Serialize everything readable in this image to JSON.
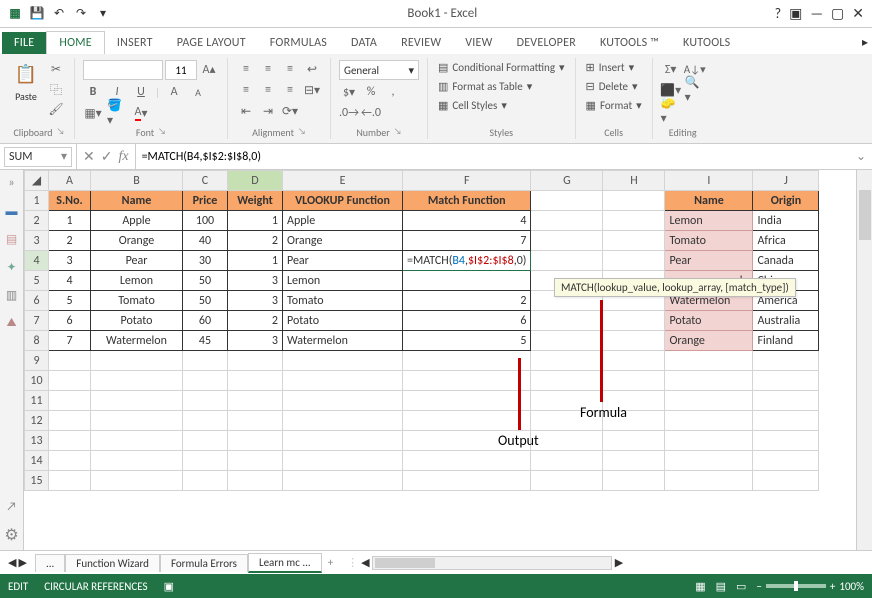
{
  "title": "Book1 - Excel",
  "tabs": {
    "file": "FILE",
    "home": "HOME",
    "insert": "INSERT",
    "page_layout": "PAGE LAYOUT",
    "formulas": "FORMULAS",
    "data": "DATA",
    "review": "REVIEW",
    "view": "VIEW",
    "developer": "DEVELOPER",
    "kutools_tm": "KUTOOLS ™",
    "kutools": "KUTOOLS"
  },
  "ribbon": {
    "clipboard": {
      "label": "Clipboard",
      "paste": "Paste"
    },
    "font": {
      "label": "Font",
      "name": "",
      "size": "11",
      "bold": "B",
      "italic": "I",
      "underline": "U"
    },
    "alignment": {
      "label": "Alignment"
    },
    "number": {
      "label": "Number",
      "format": "General"
    },
    "styles": {
      "label": "Styles",
      "cond": "Conditional Formatting",
      "table": "Format as Table",
      "cell": "Cell Styles"
    },
    "cells": {
      "label": "Cells",
      "insert": "Insert",
      "delete": "Delete",
      "format": "Format"
    },
    "editing": {
      "label": "Editing"
    }
  },
  "formula_bar": {
    "name": "SUM",
    "formula": "=MATCH(B4,$I$2:$I$8,0)"
  },
  "columns": [
    "A",
    "B",
    "C",
    "D",
    "E",
    "F",
    "G",
    "H",
    "I",
    "J"
  ],
  "header_row": {
    "sno": "S.No.",
    "name": "Name",
    "price": "Price",
    "weight": "Weight",
    "vlook": "VLOOKUP Function",
    "match": "Match Function",
    "name2": "Name",
    "origin": "Origin"
  },
  "rows": [
    {
      "r": "2",
      "sno": "1",
      "name": "Apple",
      "price": "100",
      "weight": "1",
      "vlook": "Apple",
      "match": "4",
      "name2": "Lemon",
      "origin": "India"
    },
    {
      "r": "3",
      "sno": "2",
      "name": "Orange",
      "price": "40",
      "weight": "2",
      "vlook": "Orange",
      "match": "7",
      "name2": "Tomato",
      "origin": "Africa"
    },
    {
      "r": "4",
      "sno": "3",
      "name": "Pear",
      "price": "30",
      "weight": "1",
      "vlook": "Pear",
      "match": "=MATCH(B4,$I$2:$I$8,0)",
      "name2": "Pear",
      "origin": "Canada"
    },
    {
      "r": "5",
      "sno": "4",
      "name": "Lemon",
      "price": "50",
      "weight": "3",
      "vlook": "Lemon",
      "match": "",
      "name2": "ple",
      "origin": "China"
    },
    {
      "r": "6",
      "sno": "5",
      "name": "Tomato",
      "price": "50",
      "weight": "3",
      "vlook": "Tomato",
      "match": "2",
      "name2": "Watermelon",
      "origin": "America"
    },
    {
      "r": "7",
      "sno": "6",
      "name": "Potato",
      "price": "60",
      "weight": "2",
      "vlook": "Potato",
      "match": "6",
      "name2": "Potato",
      "origin": "Australia"
    },
    {
      "r": "8",
      "sno": "7",
      "name": "Watermelon",
      "price": "45",
      "weight": "3",
      "vlook": "Watermelon",
      "match": "5",
      "name2": "Orange",
      "origin": "Finland"
    }
  ],
  "empty_rows": [
    "9",
    "10",
    "11",
    "12",
    "13",
    "14",
    "15"
  ],
  "tooltip": "MATCH(lookup_value, lookup_array, [match_type])",
  "annotation": {
    "output": "Output",
    "formula": "Formula"
  },
  "sheet_tabs": {
    "dots": "...",
    "fw": "Function Wizard",
    "fe": "Formula Errors",
    "lm": "Learn mc ...",
    "plus": "+"
  },
  "status": {
    "mode": "EDIT",
    "circ": "CIRCULAR REFERENCES",
    "zoom": "100%"
  }
}
